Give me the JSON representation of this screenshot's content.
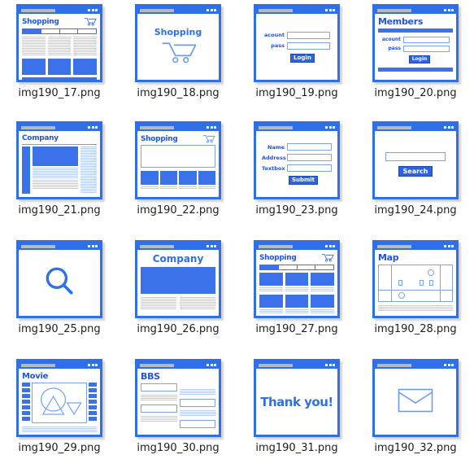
{
  "grid": {
    "columns": 4,
    "rows": 4,
    "accent_color": "#2f6fe8",
    "heading_color": "#2255d4",
    "caption_color": "#20201a",
    "background": "#ffffff"
  },
  "thumbnails": [
    {
      "id": "img190_17",
      "caption": "img190_17.png",
      "kind": "shopping-catalog",
      "heading": "Shopping",
      "icon": "shopping-cart-icon",
      "nav_items": 4,
      "nav_active_index": 0,
      "cards": 3,
      "footer_bar": true
    },
    {
      "id": "img190_18",
      "caption": "img190_18.png",
      "kind": "shopping-splash",
      "heading": "Shopping",
      "icon": "shopping-cart-icon"
    },
    {
      "id": "img190_19",
      "caption": "img190_19.png",
      "kind": "login-form",
      "fields": [
        {
          "label": "acount",
          "value": "",
          "placeholder": ""
        },
        {
          "label": "pass",
          "value": "",
          "placeholder": ""
        }
      ],
      "button": "Login"
    },
    {
      "id": "img190_20",
      "caption": "img190_20.png",
      "kind": "members-login",
      "heading": "Members",
      "fields": [
        {
          "label": "acount",
          "value": "",
          "placeholder": ""
        },
        {
          "label": "pass",
          "value": "",
          "placeholder": ""
        }
      ],
      "button": "Login",
      "footer_bar": true
    },
    {
      "id": "img190_21",
      "caption": "img190_21.png",
      "kind": "company-article",
      "heading": "Company",
      "columns": 3
    },
    {
      "id": "img190_22",
      "caption": "img190_22.png",
      "kind": "shopping-hero",
      "heading": "Shopping",
      "icon": "shopping-cart-icon",
      "cards": 4
    },
    {
      "id": "img190_23",
      "caption": "img190_23.png",
      "kind": "input-form",
      "fields": [
        {
          "label": "Name",
          "value": "",
          "placeholder": ""
        },
        {
          "label": "Address",
          "value": "",
          "placeholder": ""
        },
        {
          "label": "Textbox",
          "value": "",
          "placeholder": ""
        }
      ],
      "button": "Submit"
    },
    {
      "id": "img190_24",
      "caption": "img190_24.png",
      "kind": "search-form",
      "field": {
        "label": "",
        "value": "",
        "placeholder": ""
      },
      "button": "Search"
    },
    {
      "id": "img190_25",
      "caption": "img190_25.png",
      "kind": "search-splash",
      "icon": "magnifier-icon"
    },
    {
      "id": "img190_26",
      "caption": "img190_26.png",
      "kind": "company-landing",
      "heading": "Company",
      "cards": 2
    },
    {
      "id": "img190_27",
      "caption": "img190_27.png",
      "kind": "shopping-grid",
      "heading": "Shopping",
      "icon": "shopping-cart-icon",
      "nav_items": 4,
      "nav_active_index": 0,
      "rows": 2,
      "cols": 3
    },
    {
      "id": "img190_28",
      "caption": "img190_28.png",
      "kind": "map-page",
      "heading": "Map",
      "icon": "map-icon"
    },
    {
      "id": "img190_29",
      "caption": "img190_29.png",
      "kind": "movie-page",
      "heading": "Movie",
      "icon": "film-strip-icon"
    },
    {
      "id": "img190_30",
      "caption": "img190_30.png",
      "kind": "bbs-page",
      "heading": "BBS"
    },
    {
      "id": "img190_31",
      "caption": "img190_31.png",
      "kind": "thankyou-page",
      "heading": "Thank you!"
    },
    {
      "id": "img190_32",
      "caption": "img190_32.png",
      "kind": "mail-page",
      "icon": "envelope-icon"
    }
  ]
}
